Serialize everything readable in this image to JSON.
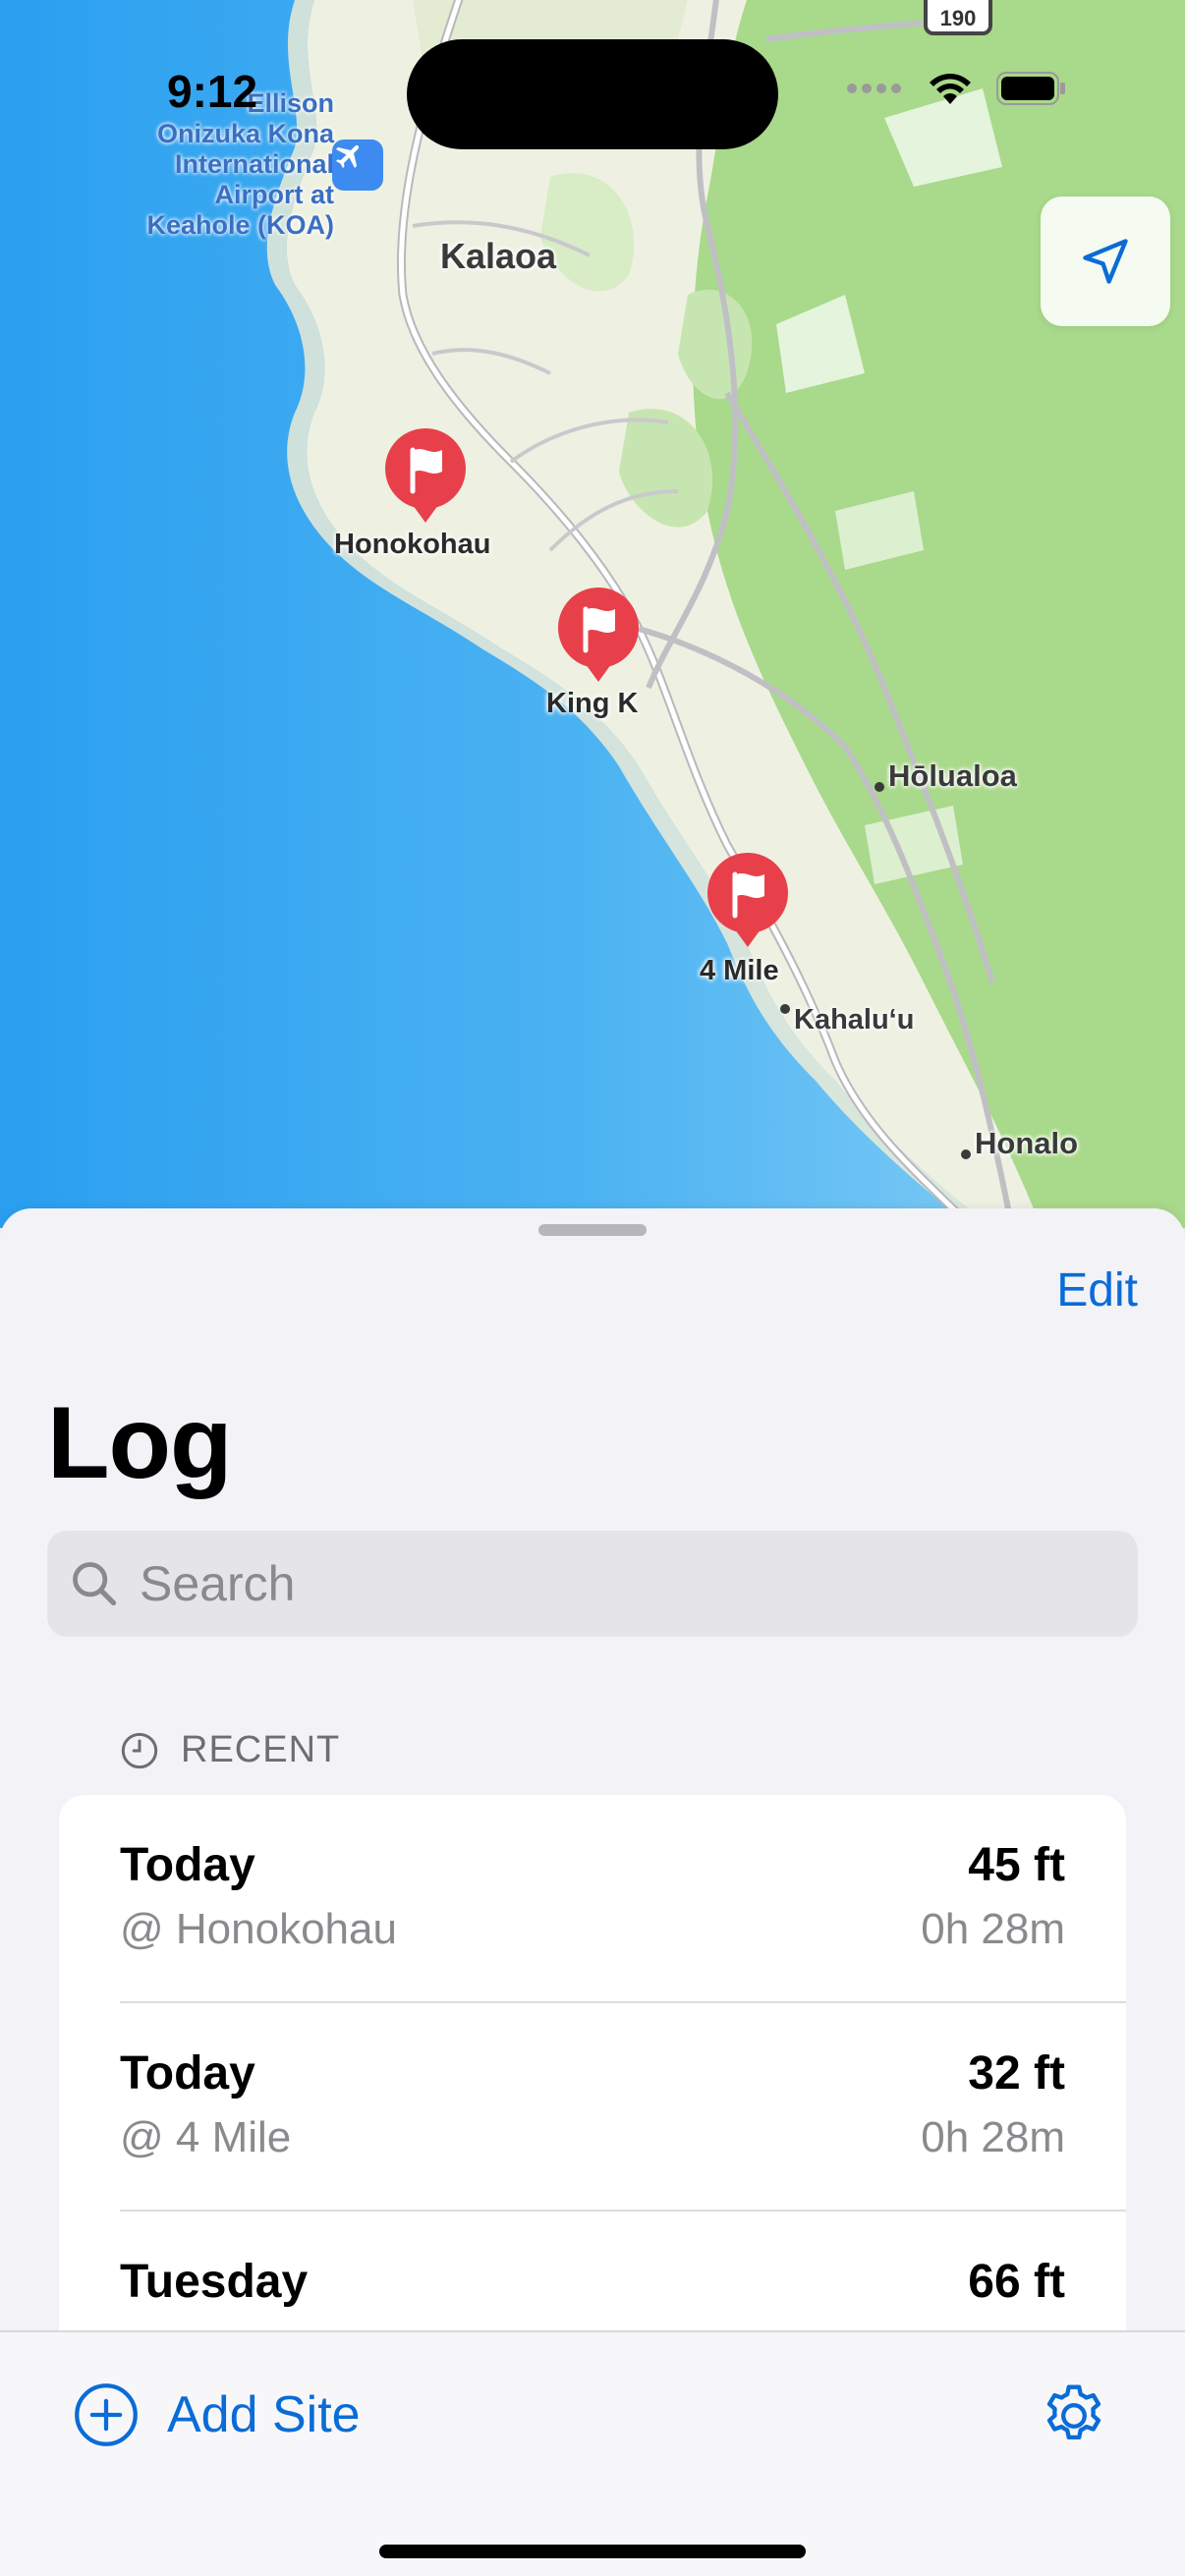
{
  "status_bar": {
    "time": "9:12"
  },
  "map": {
    "airport_label": [
      "Ellison",
      "Onizuka Kona",
      "International",
      "Airport at",
      "Keahole (KOA)"
    ],
    "route_shield": "190",
    "places": {
      "kalaoa": "Kalaoa",
      "holualoa": "Hōlualoa",
      "kahaluu": "Kahalu‘u",
      "honalo": "Honalo"
    },
    "pins": [
      {
        "label": "Honokohau"
      },
      {
        "label": "King K"
      },
      {
        "label": "4 Mile"
      }
    ],
    "pin_color": "#e8404a"
  },
  "sheet": {
    "edit_label": "Edit",
    "title": "Log",
    "search_placeholder": "Search",
    "section_title": "RECENT",
    "entries": [
      {
        "day": "Today",
        "site": "@ Honokohau",
        "depth": "45 ft",
        "duration": "0h 28m"
      },
      {
        "day": "Today",
        "site": "@ 4 Mile",
        "depth": "32 ft",
        "duration": "0h 28m"
      },
      {
        "day": "Tuesday",
        "site": "",
        "depth": "66 ft",
        "duration": ""
      }
    ]
  },
  "toolbar": {
    "add_label": "Add Site"
  },
  "colors": {
    "accent": "#0a6cd6",
    "ocean": "#3aa7ee",
    "land": "#eef1e2",
    "forest": "#a9d98b"
  }
}
